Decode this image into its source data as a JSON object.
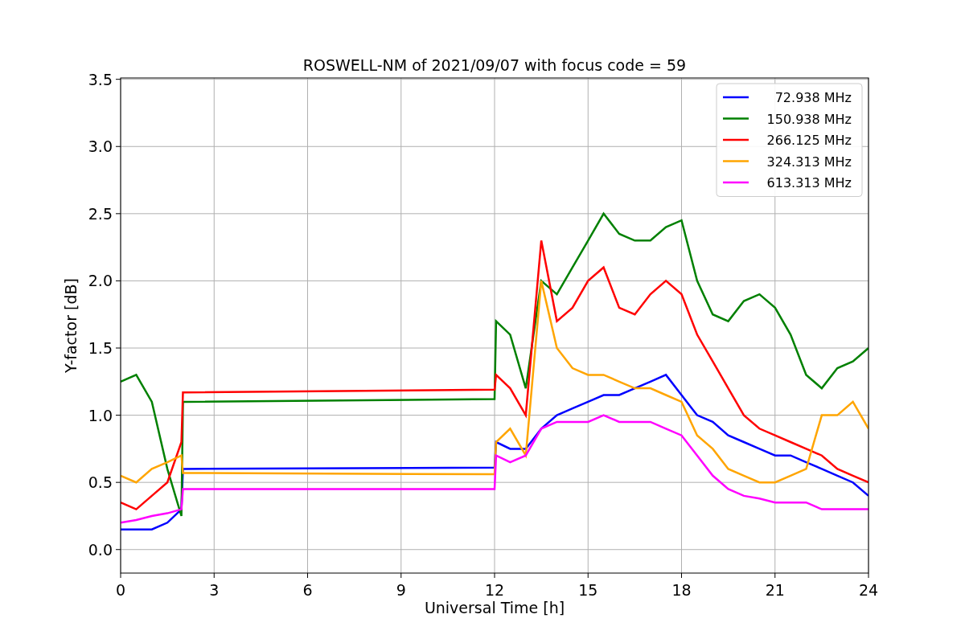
{
  "chart": {
    "chart_data": {
      "type": "line",
      "title": "ROSWELL-NM of 2021/09/07 with focus code = 59",
      "xlabel": "Universal Time [h]",
      "ylabel": "Y-factor [dB]",
      "x": [
        0,
        0.5,
        1,
        1.5,
        1.95,
        2,
        12,
        12.05,
        12.5,
        13,
        13.5,
        14,
        14.5,
        15,
        15.5,
        16,
        16.5,
        17,
        17.5,
        18,
        18.5,
        19,
        19.5,
        20,
        20.5,
        21,
        21.5,
        22,
        22.5,
        23,
        23.5,
        24
      ],
      "grid": true,
      "legend": true,
      "xlim": [
        0,
        24
      ],
      "ylim": [
        -0.175,
        3.51
      ],
      "xticks": [
        0,
        3,
        6,
        9,
        12,
        15,
        18,
        21,
        24
      ],
      "yticks": [
        {
          "value": 0,
          "label": "0.0"
        },
        {
          "value": 0.5,
          "label": "0.5"
        },
        {
          "value": 1,
          "label": "1.0"
        },
        {
          "value": 1.5,
          "label": "1.5"
        },
        {
          "value": 2,
          "label": "2.0"
        },
        {
          "value": 2.5,
          "label": "2.5"
        },
        {
          "value": 3,
          "label": "3.0"
        },
        {
          "value": 3.5,
          "label": "3.5"
        }
      ],
      "series": [
        {
          "name": "72.938 MHz",
          "color": "#0000ff",
          "values": [
            0.15,
            0.15,
            0.15,
            0.2,
            0.3,
            0.6,
            0.61,
            0.8,
            0.75,
            0.75,
            0.9,
            1.0,
            1.05,
            1.1,
            1.15,
            1.15,
            1.2,
            1.25,
            1.3,
            1.15,
            1.0,
            0.95,
            0.85,
            0.8,
            0.75,
            0.7,
            0.7,
            0.65,
            0.6,
            0.55,
            0.5,
            0.4
          ]
        },
        {
          "name": "150.938 MHz",
          "color": "#008000",
          "values": [
            1.25,
            1.3,
            1.1,
            0.6,
            0.25,
            1.1,
            1.12,
            1.7,
            1.6,
            1.2,
            2.0,
            1.9,
            2.1,
            2.3,
            2.5,
            2.35,
            2.3,
            2.3,
            2.4,
            2.45,
            2.0,
            1.75,
            1.7,
            1.85,
            1.9,
            1.8,
            1.6,
            1.3,
            1.2,
            1.35,
            1.4,
            1.5
          ]
        },
        {
          "name": "266.125 MHz",
          "color": "#ff0000",
          "values": [
            0.35,
            0.3,
            0.4,
            0.5,
            0.8,
            1.17,
            1.19,
            1.3,
            1.2,
            1.0,
            2.3,
            1.7,
            1.8,
            2.0,
            2.1,
            1.8,
            1.75,
            1.9,
            2.0,
            1.9,
            1.6,
            1.4,
            1.2,
            1.0,
            0.9,
            0.85,
            0.8,
            0.75,
            0.7,
            0.6,
            0.55,
            0.5
          ]
        },
        {
          "name": "324.313 MHz",
          "color": "#ffa500",
          "values": [
            0.55,
            0.5,
            0.6,
            0.65,
            0.7,
            0.57,
            0.56,
            0.8,
            0.9,
            0.7,
            2.0,
            1.5,
            1.35,
            1.3,
            1.3,
            1.25,
            1.2,
            1.2,
            1.15,
            1.1,
            0.85,
            0.75,
            0.6,
            0.55,
            0.5,
            0.5,
            0.55,
            0.6,
            1.0,
            1.0,
            1.1,
            0.9
          ]
        },
        {
          "name": "613.313 MHz",
          "color": "#ff00ff",
          "values": [
            0.2,
            0.22,
            0.25,
            0.27,
            0.3,
            0.45,
            0.45,
            0.7,
            0.65,
            0.7,
            0.9,
            0.95,
            0.95,
            0.95,
            1.0,
            0.95,
            0.95,
            0.95,
            0.9,
            0.85,
            0.7,
            0.55,
            0.45,
            0.4,
            0.38,
            0.35,
            0.35,
            0.35,
            0.3,
            0.3,
            0.3,
            0.3
          ]
        }
      ]
    }
  }
}
